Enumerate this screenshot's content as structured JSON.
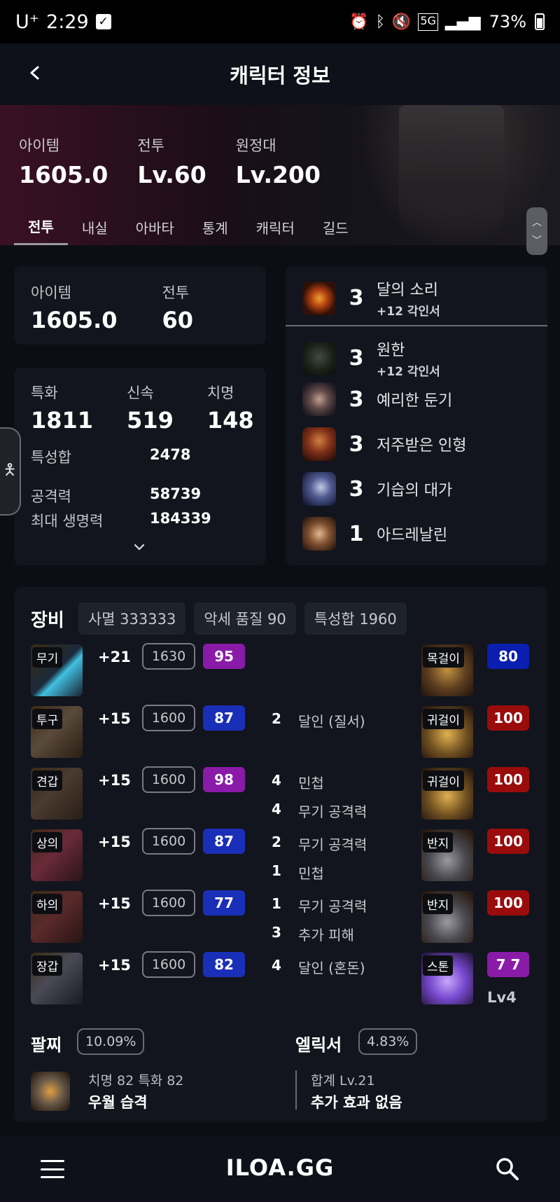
{
  "status_bar": {
    "carrier": "U⁺",
    "time": "2:29",
    "network": "5G",
    "battery": "73%"
  },
  "header": {
    "title": "캐릭터 정보"
  },
  "hero": {
    "stats": [
      {
        "label": "아이템",
        "value": "1605.0"
      },
      {
        "label": "전투",
        "value": "Lv.60"
      },
      {
        "label": "원정대",
        "value": "Lv.200"
      }
    ],
    "tabs": [
      "전투",
      "내실",
      "아바타",
      "통계",
      "캐릭터",
      "길드"
    ],
    "active_tab": "전투"
  },
  "summary": {
    "item_label": "아이템",
    "item_value": "1605.0",
    "combat_label": "전투",
    "combat_value": "60"
  },
  "stats": {
    "primary": [
      {
        "label": "특화",
        "value": "1811"
      },
      {
        "label": "신속",
        "value": "519"
      },
      {
        "label": "치명",
        "value": "148"
      }
    ],
    "total_label": "특성합",
    "total_value": "2478",
    "attack_label": "공격력",
    "attack_value": "58739",
    "hp_label": "최대 생명력",
    "hp_value": "184339"
  },
  "engravings": [
    {
      "level": "3",
      "name": "달의 소리",
      "sub": "+12 각인서"
    },
    {
      "level": "3",
      "name": "원한",
      "sub": "+12 각인서"
    },
    {
      "level": "3",
      "name": "예리한 둔기",
      "sub": ""
    },
    {
      "level": "3",
      "name": "저주받은 인형",
      "sub": ""
    },
    {
      "level": "3",
      "name": "기습의 대가",
      "sub": ""
    },
    {
      "level": "1",
      "name": "아드레날린",
      "sub": ""
    }
  ],
  "equipment": {
    "title": "장비",
    "chips": [
      "사멸 333333",
      "악세 품질 90",
      "특성합 1960"
    ],
    "gear": [
      {
        "slot": "무기",
        "enhance": "+21",
        "ilvl": "1630",
        "quality": "95",
        "quality_color": "#8a1aa8"
      },
      {
        "slot": "투구",
        "enhance": "+15",
        "ilvl": "1600",
        "quality": "87",
        "quality_color": "#1a2fb8"
      },
      {
        "slot": "견갑",
        "enhance": "+15",
        "ilvl": "1600",
        "quality": "98",
        "quality_color": "#8a1aa8"
      },
      {
        "slot": "상의",
        "enhance": "+15",
        "ilvl": "1600",
        "quality": "87",
        "quality_color": "#1a2fb8"
      },
      {
        "slot": "하의",
        "enhance": "+15",
        "ilvl": "1600",
        "quality": "77",
        "quality_color": "#1a2fb8"
      },
      {
        "slot": "장갑",
        "enhance": "+15",
        "ilvl": "1600",
        "quality": "82",
        "quality_color": "#1a2fb8"
      }
    ],
    "traits": [
      {
        "num": "2",
        "name": "달인 (질서)"
      },
      {
        "num": "4",
        "name": "민첩"
      },
      {
        "num": "4",
        "name": "무기 공격력"
      },
      {
        "num": "2",
        "name": "무기 공격력"
      },
      {
        "num": "1",
        "name": "민첩"
      },
      {
        "num": "1",
        "name": "무기 공격력"
      },
      {
        "num": "3",
        "name": "추가 피해"
      },
      {
        "num": "4",
        "name": "달인 (혼돈)"
      }
    ],
    "accessories": [
      {
        "slot": "목걸이",
        "quality": "80",
        "quality_color": "#0a1fb0"
      },
      {
        "slot": "귀걸이",
        "quality": "100",
        "quality_color": "#9a0c0c"
      },
      {
        "slot": "귀걸이",
        "quality": "100",
        "quality_color": "#9a0c0c"
      },
      {
        "slot": "반지",
        "quality": "100",
        "quality_color": "#9a0c0c"
      },
      {
        "slot": "반지",
        "quality": "100",
        "quality_color": "#9a0c0c"
      },
      {
        "slot": "스톤",
        "quality": "7 7",
        "quality_color": "#8a1aa8"
      }
    ],
    "stone_level": "Lv4"
  },
  "bracelet": {
    "title": "팔찌",
    "percent": "10.09%",
    "stats": "치명 82  특화 82",
    "effect": "우월  습격"
  },
  "elixir": {
    "title": "엘릭서",
    "percent": "4.83%",
    "total": "합계 Lv.21",
    "effect": "추가 효과 없음"
  },
  "bottom_nav": {
    "logo": "ILOA.GG"
  }
}
